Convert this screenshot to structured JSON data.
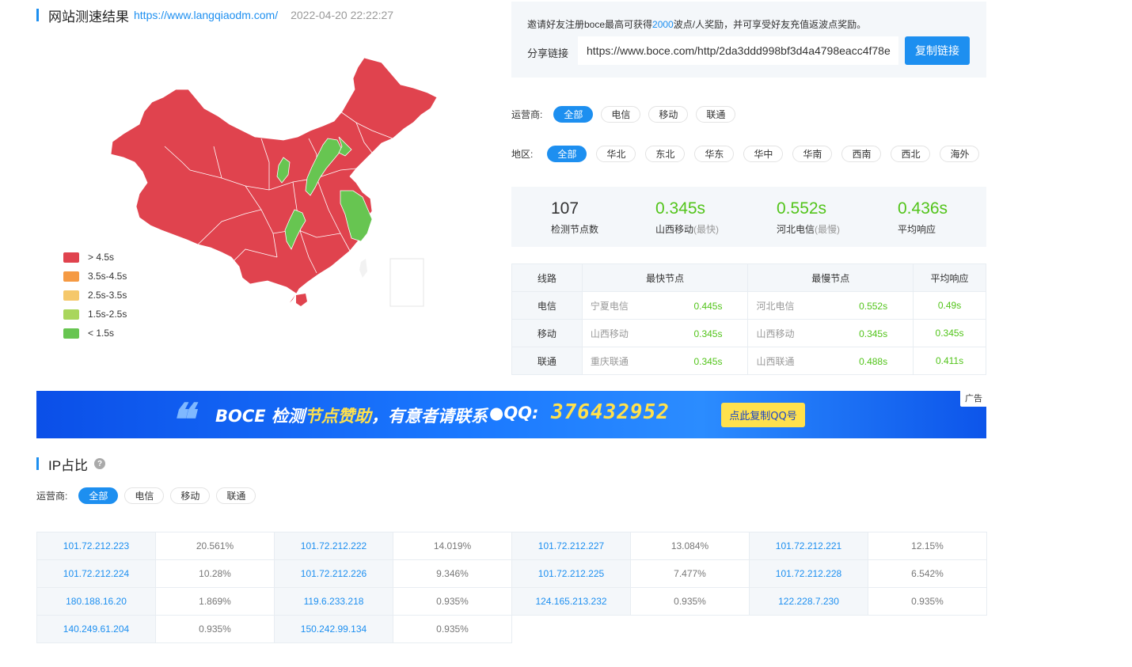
{
  "header": {
    "title": "网站测速结果",
    "url": "https://www.langqiaodm.com/",
    "time": "2022-04-20 22:22:27"
  },
  "legend": [
    {
      "label": "> 4.5s",
      "color": "#e0434e"
    },
    {
      "label": "3.5s-4.5s",
      "color": "#f59a43"
    },
    {
      "label": "2.5s-3.5s",
      "color": "#f5c86b"
    },
    {
      "label": "1.5s-2.5s",
      "color": "#a9d65c"
    },
    {
      "label": "< 1.5s",
      "color": "#67c551"
    }
  ],
  "invite": {
    "text_before": "邀请好友注册boce最高可获得",
    "highlight": "2000",
    "text_after": "波点/人奖励，并可享受好友充值返波点奖励。",
    "share_label": "分享链接",
    "share_value": "https://www.boce.com/http/2da3ddd998bf3d4a4798eacc4f78e",
    "copy_button": "复制链接"
  },
  "operator_filter": {
    "label": "运营商:",
    "options": [
      "全部",
      "电信",
      "移动",
      "联通"
    ],
    "active": "全部"
  },
  "region_filter": {
    "label": "地区:",
    "options": [
      "全部",
      "华北",
      "东北",
      "华东",
      "华中",
      "华南",
      "西南",
      "西北",
      "海外"
    ],
    "active": "全部"
  },
  "stats": {
    "nodes": {
      "value": "107",
      "label": "检测节点数"
    },
    "fastest": {
      "value": "0.345s",
      "label": "山西移动",
      "suffix": "(最快)"
    },
    "slowest": {
      "value": "0.552s",
      "label": "河北电信",
      "suffix": "(最慢)"
    },
    "average": {
      "value": "0.436s",
      "label": "平均响应"
    }
  },
  "route_table": {
    "headers": [
      "线路",
      "最快节点",
      "最慢节点",
      "平均响应"
    ],
    "rows": [
      {
        "line": "电信",
        "fast_node": "宁夏电信",
        "fast_time": "0.445s",
        "slow_node": "河北电信",
        "slow_time": "0.552s",
        "avg": "0.49s"
      },
      {
        "line": "移动",
        "fast_node": "山西移动",
        "fast_time": "0.345s",
        "slow_node": "山西移动",
        "slow_time": "0.345s",
        "avg": "0.345s"
      },
      {
        "line": "联通",
        "fast_node": "重庆联通",
        "fast_time": "0.345s",
        "slow_node": "山西联通",
        "slow_time": "0.488s",
        "avg": "0.411s"
      }
    ]
  },
  "banner": {
    "text_prefix": "BOCE 检测",
    "text_highlight": "节点赞助",
    "text_suffix": "，有意者请联系",
    "qq_label": "QQ:",
    "qq_number": "376432952",
    "button": "点此复制QQ号",
    "ad_tag": "广告"
  },
  "ip_section": {
    "title": "IP占比",
    "operator_label": "运营商:",
    "options": [
      "全部",
      "电信",
      "移动",
      "联通"
    ],
    "active": "全部"
  },
  "ip_table": [
    [
      [
        "101.72.212.223",
        "20.561%"
      ],
      [
        "101.72.212.222",
        "14.019%"
      ],
      [
        "101.72.212.227",
        "13.084%"
      ],
      [
        "101.72.212.221",
        "12.15%"
      ]
    ],
    [
      [
        "101.72.212.224",
        "10.28%"
      ],
      [
        "101.72.212.226",
        "9.346%"
      ],
      [
        "101.72.212.225",
        "7.477%"
      ],
      [
        "101.72.212.228",
        "6.542%"
      ]
    ],
    [
      [
        "180.188.16.20",
        "1.869%"
      ],
      [
        "119.6.233.218",
        "0.935%"
      ],
      [
        "124.165.213.232",
        "0.935%"
      ],
      [
        "122.228.7.230",
        "0.935%"
      ]
    ],
    [
      [
        "140.249.61.204",
        "0.935%"
      ],
      [
        "150.242.99.134",
        "0.935%"
      ]
    ]
  ]
}
